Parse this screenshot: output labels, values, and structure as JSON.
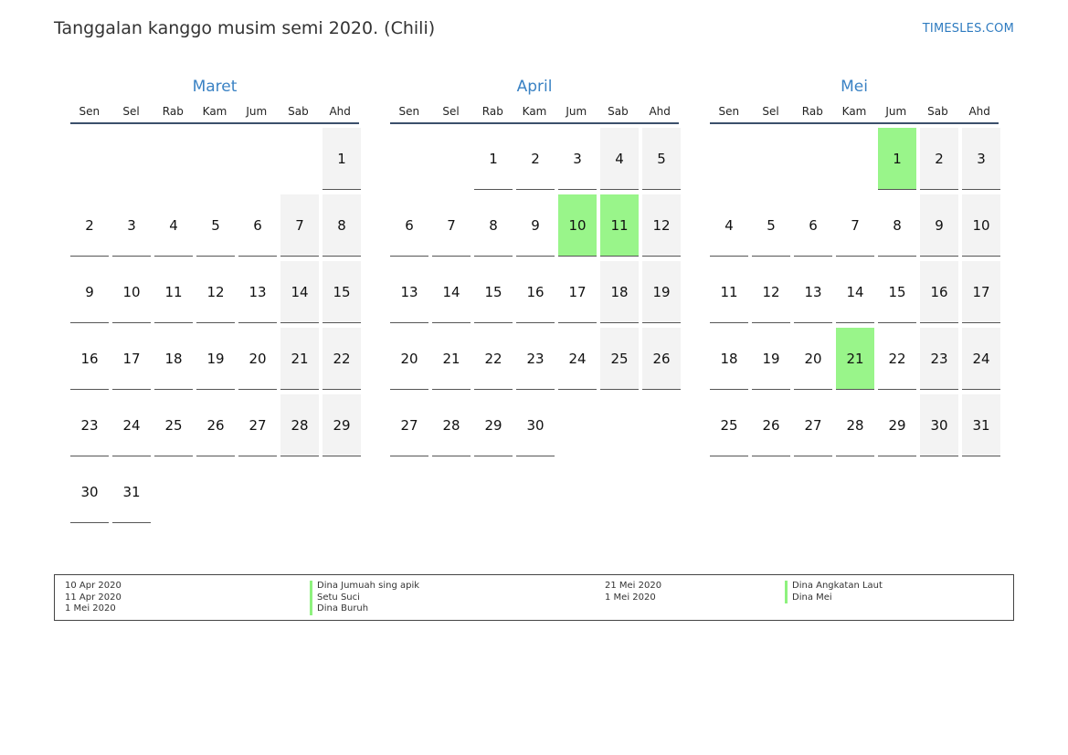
{
  "header": {
    "title": "Tanggalan kanggo musim semi 2020. (Chili)",
    "site": "TIMESLES.COM"
  },
  "weekdays": [
    "Sen",
    "Sel",
    "Rab",
    "Kam",
    "Jum",
    "Sab",
    "Ahd"
  ],
  "colors": {
    "holiday": "#99f58a",
    "weekend": "#f3f3f3",
    "month_name": "#3a82c4"
  },
  "months": [
    {
      "name": "Maret",
      "first_weekday_index": 6,
      "days_in_month": 31,
      "holidays": []
    },
    {
      "name": "April",
      "first_weekday_index": 2,
      "days_in_month": 30,
      "holidays": [
        10,
        11
      ]
    },
    {
      "name": "Mei",
      "first_weekday_index": 4,
      "days_in_month": 31,
      "holidays": [
        1,
        21
      ]
    }
  ],
  "legend": {
    "left": [
      {
        "date": "10 Apr 2020",
        "name": "Dina Jumuah sing apik"
      },
      {
        "date": "11 Apr 2020",
        "name": "Setu Suci"
      },
      {
        "date": "1 Mei 2020",
        "name": "Dina Buruh"
      }
    ],
    "right": [
      {
        "date": "21 Mei 2020",
        "name": "Dina Angkatan Laut"
      },
      {
        "date": "1 Mei 2020",
        "name": "Dina Mei"
      }
    ]
  }
}
